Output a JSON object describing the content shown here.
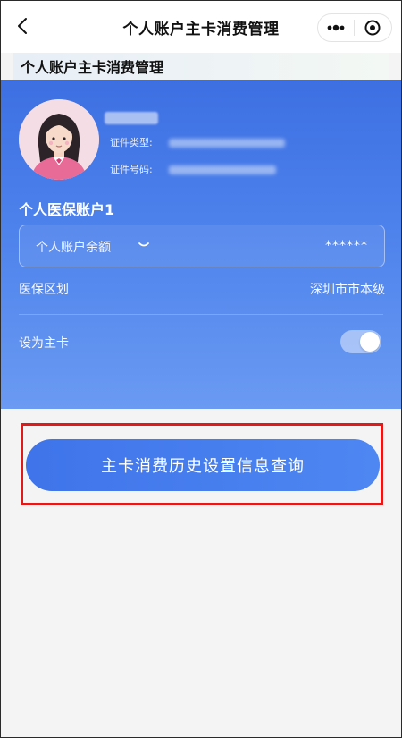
{
  "navbar": {
    "title": "个人账户主卡消费管理",
    "back_icon": "chevron-left-icon",
    "more_icon": "more-dots-icon",
    "close_icon": "target-circle-icon"
  },
  "section": {
    "title": "个人账户主卡消费管理"
  },
  "card": {
    "id_type_label": "证件类型:",
    "id_number_label": "证件号码:",
    "account_title": "个人医保账户1",
    "balance_label": "个人账户余额",
    "balance_value": "******",
    "region_label": "医保区划",
    "region_value": "深圳市市本级",
    "primary_card_label": "设为主卡",
    "primary_card_enabled": true
  },
  "actions": {
    "history_query_button": "主卡消费历史设置信息查询"
  },
  "colors": {
    "accent": "#3f74ea",
    "highlight_border": "#e01919"
  }
}
